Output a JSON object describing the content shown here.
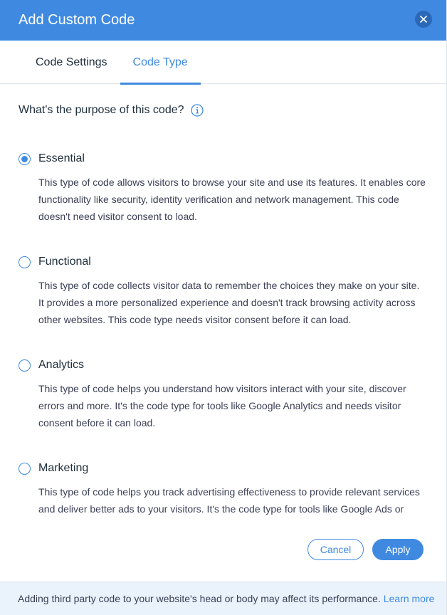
{
  "dialog": {
    "title": "Add Custom Code"
  },
  "tabs": [
    {
      "label": "Code Settings",
      "active": false
    },
    {
      "label": "Code Type",
      "active": true
    }
  ],
  "question": "What's the purpose of this code?",
  "options": [
    {
      "label": "Essential",
      "checked": true,
      "description": "This type of code allows visitors to browse your site and use its features. It enables core functionality like security, identity verification and network management. This code doesn't need visitor consent to load."
    },
    {
      "label": "Functional",
      "checked": false,
      "description": "This type of code collects visitor data to remember the choices they make on your site. It provides a more personalized experience and doesn't track browsing activity across other websites. This code type needs visitor consent before it can load."
    },
    {
      "label": "Analytics",
      "checked": false,
      "description": "This type of code helps you understand how visitors interact with your site, discover errors and more. It's the code type for tools like Google Analytics and needs visitor consent before it can load."
    },
    {
      "label": "Marketing",
      "checked": false,
      "description": "This type of code helps you track advertising effectiveness to provide relevant services and deliver better ads to your visitors. It's the code type for tools like Google Ads or"
    }
  ],
  "buttons": {
    "cancel": "Cancel",
    "apply": "Apply"
  },
  "notice": {
    "text": "Adding third party code to your website's head or body may affect its performance.",
    "link": "Learn more"
  },
  "colors": {
    "accent": "#3f8ae0",
    "header_bg": "#3f8ae0",
    "notice_bg": "#eaf2fc"
  },
  "icons": {
    "close": "close-icon",
    "info": "info-icon"
  }
}
